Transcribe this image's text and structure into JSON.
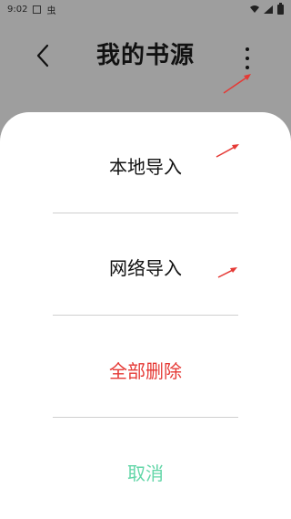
{
  "status_bar": {
    "time": "9:02",
    "app_glyph": "虫"
  },
  "header": {
    "title": "我的书源"
  },
  "sheet": {
    "options": [
      {
        "label": "本地导入"
      },
      {
        "label": "网络导入"
      },
      {
        "label": "全部删除"
      },
      {
        "label": "取消"
      }
    ]
  },
  "colors": {
    "overlay": "#9e9e9e",
    "delete": "#e53935",
    "cancel": "#63d6a8",
    "annotation_arrow": "#e53935"
  }
}
